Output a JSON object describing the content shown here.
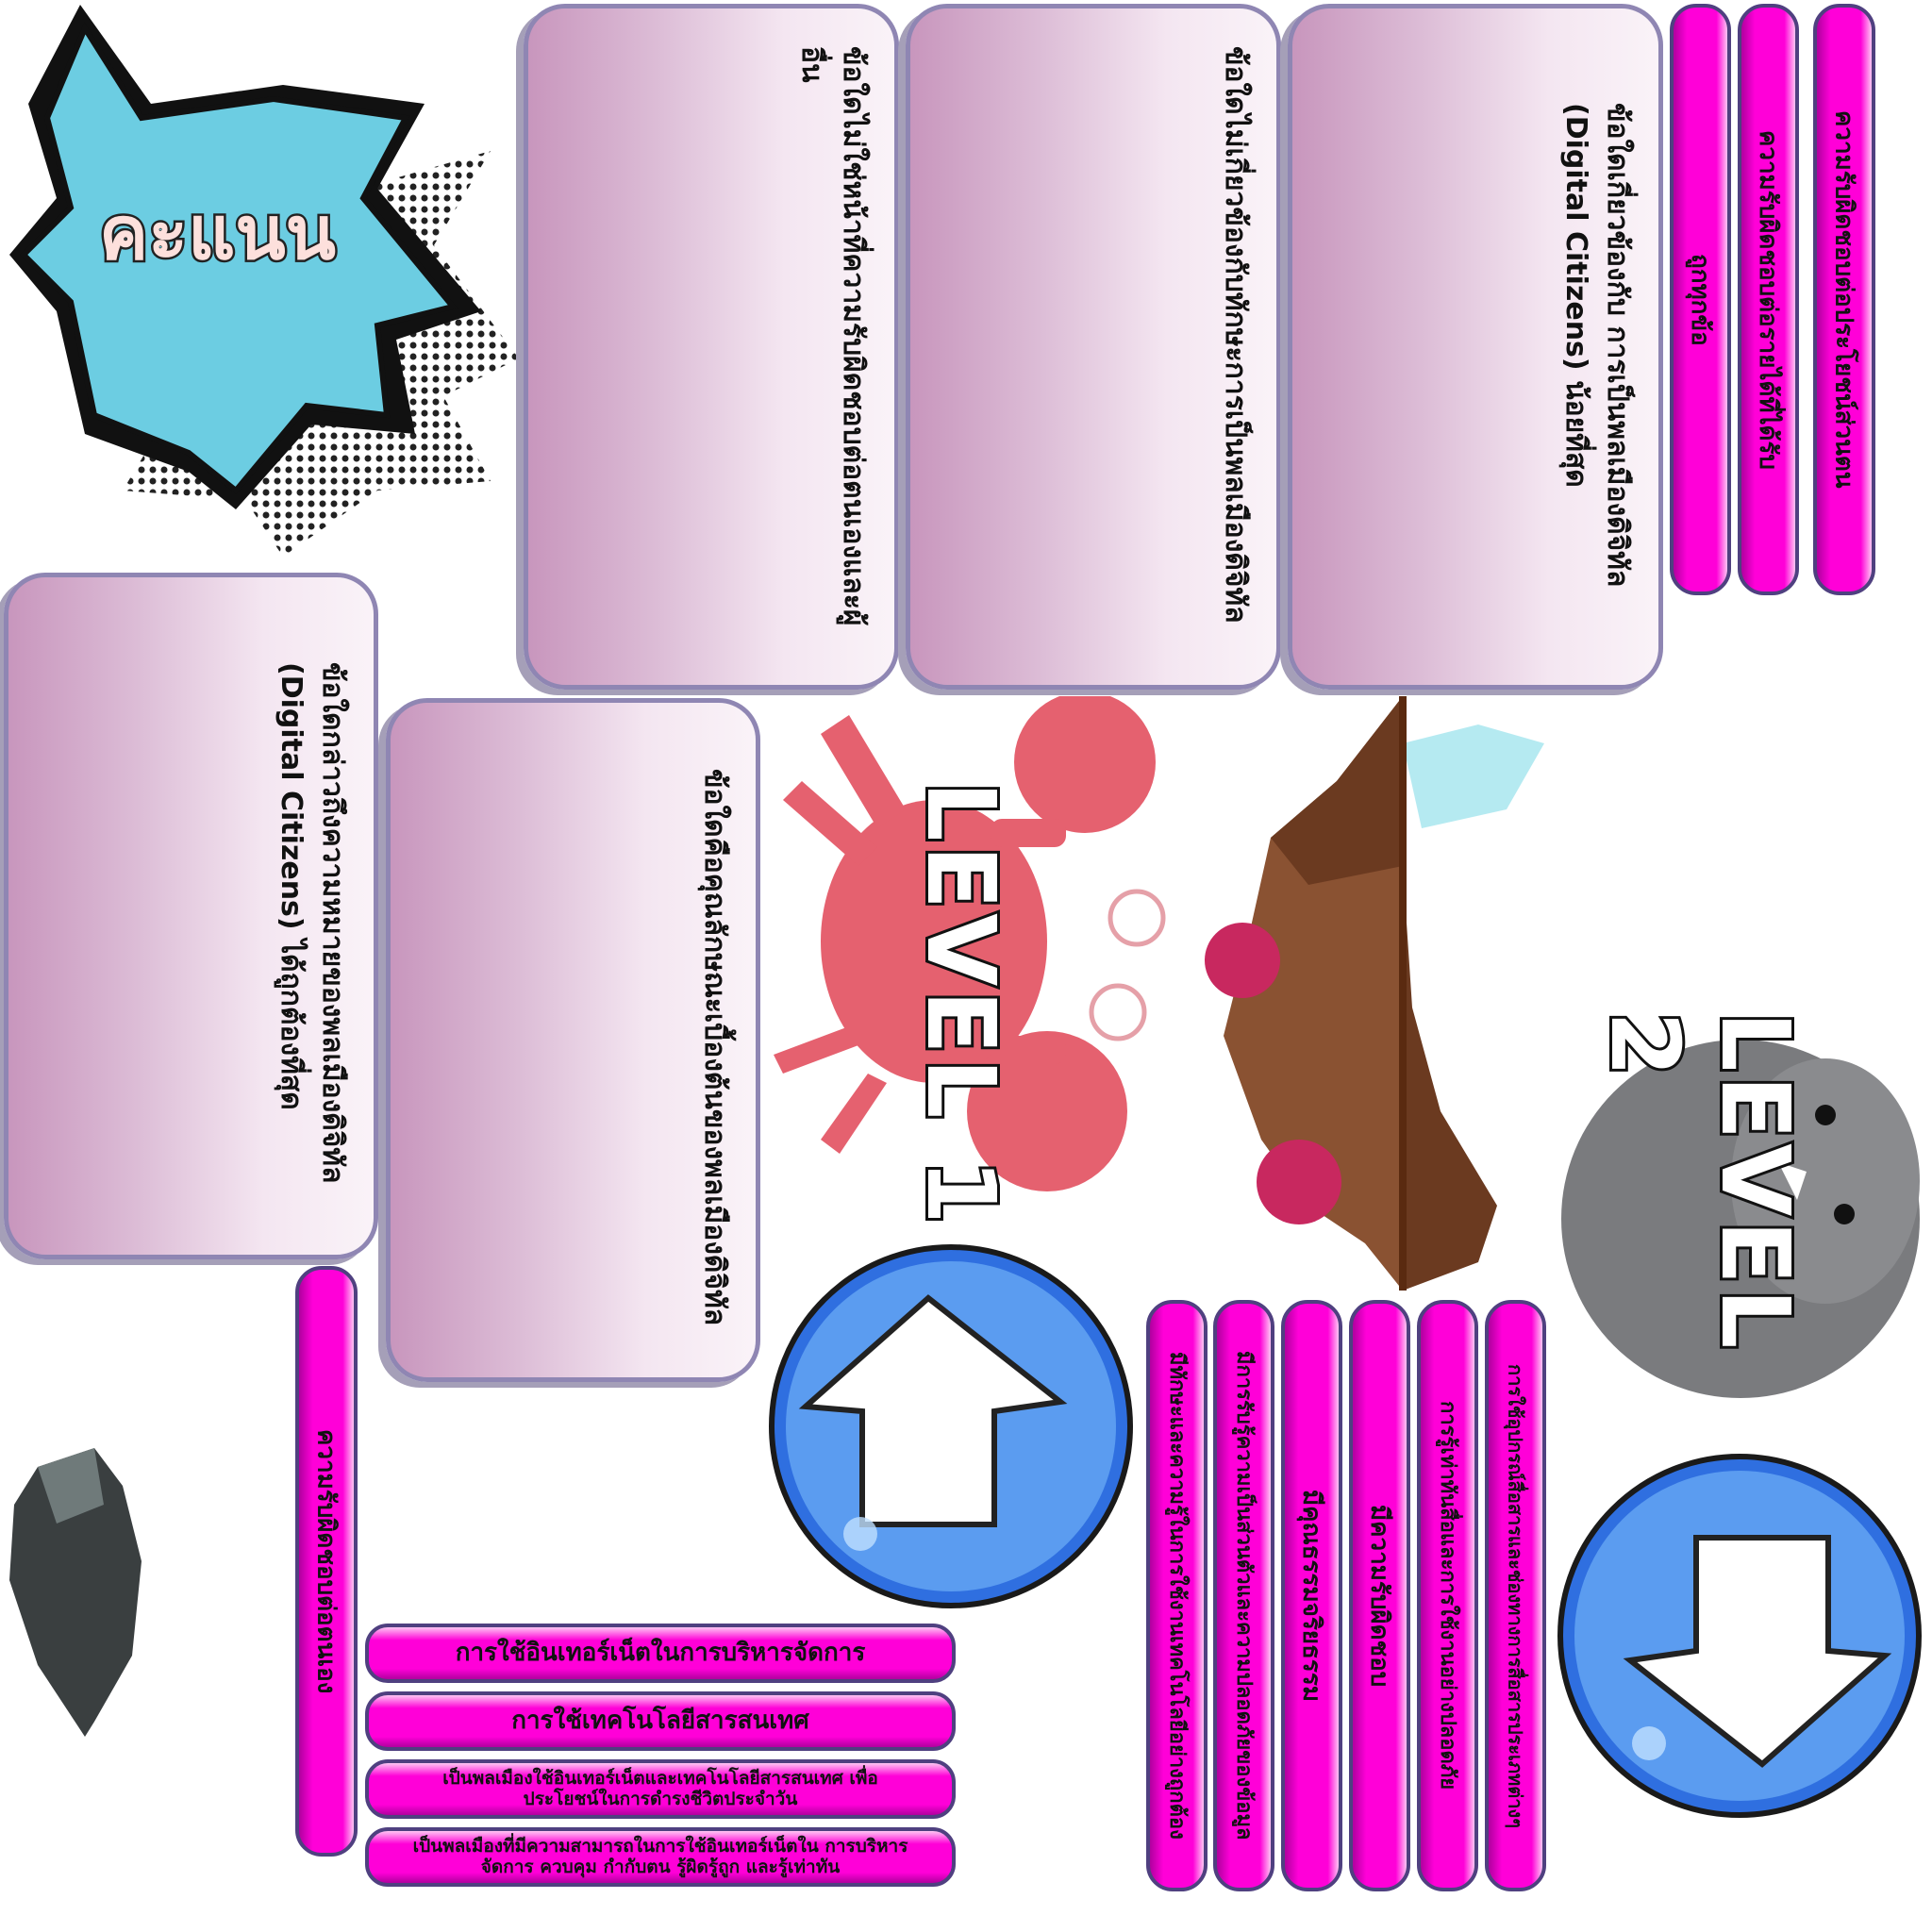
{
  "score_burst": {
    "label": "คะแนน",
    "color": "#6ccde2"
  },
  "question_cards": [
    {
      "id": "q1",
      "text": "ข้อใดไม่ใช่หน้าที่ความรับผิดชอบต่อตนเองและผู้อื่น"
    },
    {
      "id": "q2",
      "text": "ข้อใดไม่เกี่ยวข้องกับทักษะการเป็นพลเมืองดิจิทัล"
    },
    {
      "id": "q3",
      "text": "ข้อใดเกี่ยวข้องกับ การเป็นพลเมืองดิจิทัล (Digital Citizens) น้อยที่สุด"
    },
    {
      "id": "q4",
      "text": "ข้อใดกล่าวถึงความหมายของพลเมืองดิจิทัล (Digital Citizens) ได้ถูกต้องที่สุด"
    },
    {
      "id": "q5",
      "text": "ข้อใดคือคุณลักษณะเบื้องต้นของพลเมืองดิจิทัล"
    }
  ],
  "answers_top": [
    "ถูกทุกข้อ",
    "ความรับผิดชอบต่อรายได้ที่ได้รับ",
    "ความรับผิดชอบต่อประโยชน์ส่วนตน"
  ],
  "answer_left": "ความรับผิดชอบต่อตนเอง",
  "answers_horizontal": [
    "การใช้อินเทอร์เน็ตในการบริหารจัดการ",
    "การใช้เทคโนโลยีสารสนเทศ",
    "เป็นพลเมืองใช้อินเทอร์เน็ตและเทคโนโลยีสารสนเทศ เพื่อประโยชน์ในการดำรงชีวิตประจำวัน",
    "เป็นพลเมืองที่มีความสามารถในการใช้อินเทอร์เน็ตใน การบริหารจัดการ ควบคุม กำกับตน รู้ผิดรู้ถูก และรู้เท่าทัน"
  ],
  "answers_bottom": [
    "มีทักษะและความรู้ในการใช้งานเทคโนโลยีอย่างถูกต้อง",
    "มีการรับรู้ความเป็นส่วนตัวและความปลอดภัยของข้อมูล",
    "มีคุณธรรมจริยธรรม",
    "มีความรับผิดชอบ",
    "การรู้เท่าทันสื่อและการใช้งานอย่างปลอดภัย",
    "การใช้อุปกรณ์สื่อสารและช่องทางการสื่อสารประเภทต่างๆ"
  ],
  "levels": [
    "LEVEL 1",
    "LEVEL 2"
  ],
  "colors": {
    "pill": "#ff00d8",
    "card_border": "#8f86b3",
    "button_blue": "#2f6fe0"
  }
}
